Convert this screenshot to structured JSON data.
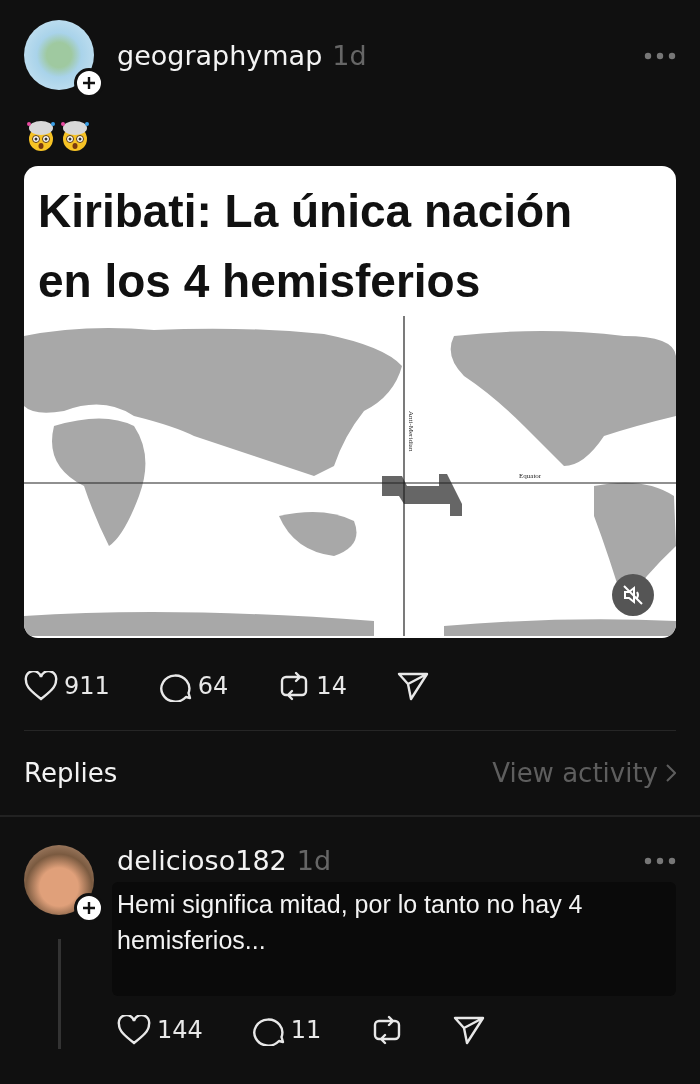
{
  "post": {
    "username": "geographymap",
    "time": "1d",
    "image": {
      "title_lines": [
        "Kiribati: La única nación",
        "en los 4 hemisferios"
      ],
      "map_labels": {
        "meridian": "Anti-Meridian",
        "equator": "Equator"
      },
      "muted": true
    },
    "actions": {
      "likes": "911",
      "comments": "64",
      "reposts": "14"
    }
  },
  "replies_header": {
    "title": "Replies",
    "link": "View activity"
  },
  "replies": [
    {
      "username": "delicioso182",
      "time": "1d",
      "text": "Hemi significa mitad, por lo tanto no hay 4 hemisferios...",
      "actions": {
        "likes": "144",
        "comments": "11"
      }
    }
  ]
}
